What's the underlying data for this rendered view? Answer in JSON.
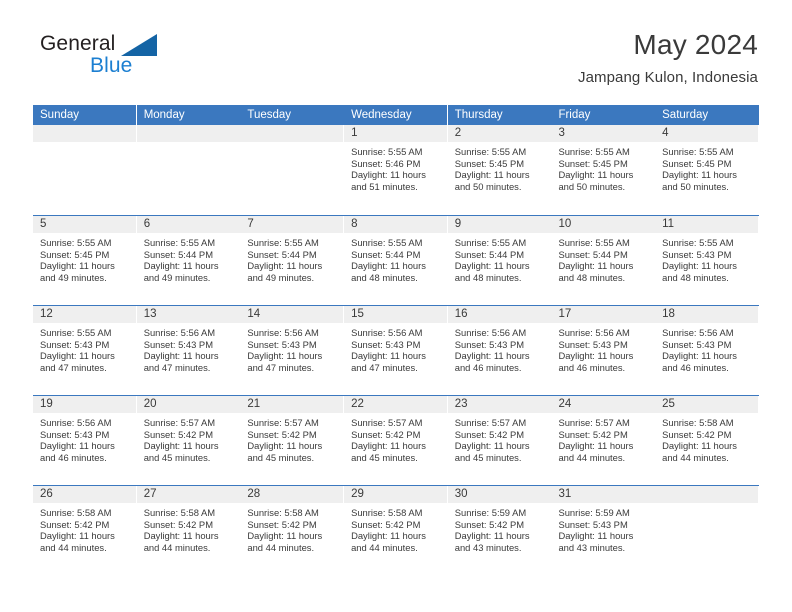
{
  "brand": {
    "name_top": "General",
    "name_bottom": "Blue",
    "accent_color": "#1c7fd1",
    "triangle_color": "#1464a5"
  },
  "header": {
    "title": "May 2024",
    "subtitle": "Jampang Kulon, Indonesia"
  },
  "theme": {
    "header_blue": "#3b78bf",
    "daynum_band": "#efefef",
    "text": "#3a3a3a"
  },
  "weekdays": [
    "Sunday",
    "Monday",
    "Tuesday",
    "Wednesday",
    "Thursday",
    "Friday",
    "Saturday"
  ],
  "weeks": [
    [
      {
        "day": "",
        "sunrise": "",
        "sunset": "",
        "daylight_1": "",
        "daylight_2": ""
      },
      {
        "day": "",
        "sunrise": "",
        "sunset": "",
        "daylight_1": "",
        "daylight_2": ""
      },
      {
        "day": "",
        "sunrise": "",
        "sunset": "",
        "daylight_1": "",
        "daylight_2": ""
      },
      {
        "day": "1",
        "sunrise": "Sunrise: 5:55 AM",
        "sunset": "Sunset: 5:46 PM",
        "daylight_1": "Daylight: 11 hours",
        "daylight_2": "and 51 minutes."
      },
      {
        "day": "2",
        "sunrise": "Sunrise: 5:55 AM",
        "sunset": "Sunset: 5:45 PM",
        "daylight_1": "Daylight: 11 hours",
        "daylight_2": "and 50 minutes."
      },
      {
        "day": "3",
        "sunrise": "Sunrise: 5:55 AM",
        "sunset": "Sunset: 5:45 PM",
        "daylight_1": "Daylight: 11 hours",
        "daylight_2": "and 50 minutes."
      },
      {
        "day": "4",
        "sunrise": "Sunrise: 5:55 AM",
        "sunset": "Sunset: 5:45 PM",
        "daylight_1": "Daylight: 11 hours",
        "daylight_2": "and 50 minutes."
      }
    ],
    [
      {
        "day": "5",
        "sunrise": "Sunrise: 5:55 AM",
        "sunset": "Sunset: 5:45 PM",
        "daylight_1": "Daylight: 11 hours",
        "daylight_2": "and 49 minutes."
      },
      {
        "day": "6",
        "sunrise": "Sunrise: 5:55 AM",
        "sunset": "Sunset: 5:44 PM",
        "daylight_1": "Daylight: 11 hours",
        "daylight_2": "and 49 minutes."
      },
      {
        "day": "7",
        "sunrise": "Sunrise: 5:55 AM",
        "sunset": "Sunset: 5:44 PM",
        "daylight_1": "Daylight: 11 hours",
        "daylight_2": "and 49 minutes."
      },
      {
        "day": "8",
        "sunrise": "Sunrise: 5:55 AM",
        "sunset": "Sunset: 5:44 PM",
        "daylight_1": "Daylight: 11 hours",
        "daylight_2": "and 48 minutes."
      },
      {
        "day": "9",
        "sunrise": "Sunrise: 5:55 AM",
        "sunset": "Sunset: 5:44 PM",
        "daylight_1": "Daylight: 11 hours",
        "daylight_2": "and 48 minutes."
      },
      {
        "day": "10",
        "sunrise": "Sunrise: 5:55 AM",
        "sunset": "Sunset: 5:44 PM",
        "daylight_1": "Daylight: 11 hours",
        "daylight_2": "and 48 minutes."
      },
      {
        "day": "11",
        "sunrise": "Sunrise: 5:55 AM",
        "sunset": "Sunset: 5:43 PM",
        "daylight_1": "Daylight: 11 hours",
        "daylight_2": "and 48 minutes."
      }
    ],
    [
      {
        "day": "12",
        "sunrise": "Sunrise: 5:55 AM",
        "sunset": "Sunset: 5:43 PM",
        "daylight_1": "Daylight: 11 hours",
        "daylight_2": "and 47 minutes."
      },
      {
        "day": "13",
        "sunrise": "Sunrise: 5:56 AM",
        "sunset": "Sunset: 5:43 PM",
        "daylight_1": "Daylight: 11 hours",
        "daylight_2": "and 47 minutes."
      },
      {
        "day": "14",
        "sunrise": "Sunrise: 5:56 AM",
        "sunset": "Sunset: 5:43 PM",
        "daylight_1": "Daylight: 11 hours",
        "daylight_2": "and 47 minutes."
      },
      {
        "day": "15",
        "sunrise": "Sunrise: 5:56 AM",
        "sunset": "Sunset: 5:43 PM",
        "daylight_1": "Daylight: 11 hours",
        "daylight_2": "and 47 minutes."
      },
      {
        "day": "16",
        "sunrise": "Sunrise: 5:56 AM",
        "sunset": "Sunset: 5:43 PM",
        "daylight_1": "Daylight: 11 hours",
        "daylight_2": "and 46 minutes."
      },
      {
        "day": "17",
        "sunrise": "Sunrise: 5:56 AM",
        "sunset": "Sunset: 5:43 PM",
        "daylight_1": "Daylight: 11 hours",
        "daylight_2": "and 46 minutes."
      },
      {
        "day": "18",
        "sunrise": "Sunrise: 5:56 AM",
        "sunset": "Sunset: 5:43 PM",
        "daylight_1": "Daylight: 11 hours",
        "daylight_2": "and 46 minutes."
      }
    ],
    [
      {
        "day": "19",
        "sunrise": "Sunrise: 5:56 AM",
        "sunset": "Sunset: 5:43 PM",
        "daylight_1": "Daylight: 11 hours",
        "daylight_2": "and 46 minutes."
      },
      {
        "day": "20",
        "sunrise": "Sunrise: 5:57 AM",
        "sunset": "Sunset: 5:42 PM",
        "daylight_1": "Daylight: 11 hours",
        "daylight_2": "and 45 minutes."
      },
      {
        "day": "21",
        "sunrise": "Sunrise: 5:57 AM",
        "sunset": "Sunset: 5:42 PM",
        "daylight_1": "Daylight: 11 hours",
        "daylight_2": "and 45 minutes."
      },
      {
        "day": "22",
        "sunrise": "Sunrise: 5:57 AM",
        "sunset": "Sunset: 5:42 PM",
        "daylight_1": "Daylight: 11 hours",
        "daylight_2": "and 45 minutes."
      },
      {
        "day": "23",
        "sunrise": "Sunrise: 5:57 AM",
        "sunset": "Sunset: 5:42 PM",
        "daylight_1": "Daylight: 11 hours",
        "daylight_2": "and 45 minutes."
      },
      {
        "day": "24",
        "sunrise": "Sunrise: 5:57 AM",
        "sunset": "Sunset: 5:42 PM",
        "daylight_1": "Daylight: 11 hours",
        "daylight_2": "and 44 minutes."
      },
      {
        "day": "25",
        "sunrise": "Sunrise: 5:58 AM",
        "sunset": "Sunset: 5:42 PM",
        "daylight_1": "Daylight: 11 hours",
        "daylight_2": "and 44 minutes."
      }
    ],
    [
      {
        "day": "26",
        "sunrise": "Sunrise: 5:58 AM",
        "sunset": "Sunset: 5:42 PM",
        "daylight_1": "Daylight: 11 hours",
        "daylight_2": "and 44 minutes."
      },
      {
        "day": "27",
        "sunrise": "Sunrise: 5:58 AM",
        "sunset": "Sunset: 5:42 PM",
        "daylight_1": "Daylight: 11 hours",
        "daylight_2": "and 44 minutes."
      },
      {
        "day": "28",
        "sunrise": "Sunrise: 5:58 AM",
        "sunset": "Sunset: 5:42 PM",
        "daylight_1": "Daylight: 11 hours",
        "daylight_2": "and 44 minutes."
      },
      {
        "day": "29",
        "sunrise": "Sunrise: 5:58 AM",
        "sunset": "Sunset: 5:42 PM",
        "daylight_1": "Daylight: 11 hours",
        "daylight_2": "and 44 minutes."
      },
      {
        "day": "30",
        "sunrise": "Sunrise: 5:59 AM",
        "sunset": "Sunset: 5:42 PM",
        "daylight_1": "Daylight: 11 hours",
        "daylight_2": "and 43 minutes."
      },
      {
        "day": "31",
        "sunrise": "Sunrise: 5:59 AM",
        "sunset": "Sunset: 5:43 PM",
        "daylight_1": "Daylight: 11 hours",
        "daylight_2": "and 43 minutes."
      },
      {
        "day": "",
        "sunrise": "",
        "sunset": "",
        "daylight_1": "",
        "daylight_2": ""
      }
    ]
  ]
}
